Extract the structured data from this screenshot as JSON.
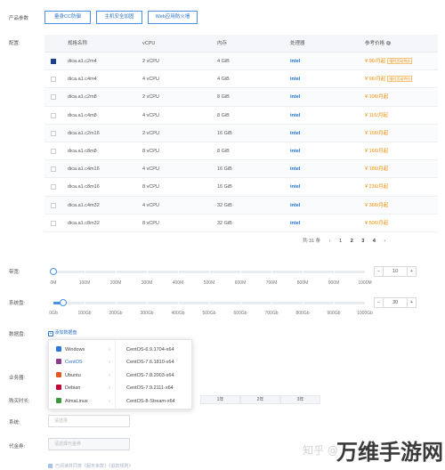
{
  "product": {
    "label": "产品参数",
    "buttons": [
      "量身CC防御",
      "主机安全加固",
      "Web应用防火墙"
    ]
  },
  "config": {
    "label": "配置:"
  },
  "table": {
    "headers": [
      "",
      "规格名称",
      "vCPU",
      "内存",
      "处理器",
      "参考价格"
    ],
    "rows": [
      {
        "name": "dica.a1.c2m4",
        "vcpu": "2 vCPU",
        "mem": "4 GiB",
        "cpu": "intel",
        "price": "¥ 96/月起",
        "badge": "限时活动特价",
        "checked": true
      },
      {
        "name": "dica.a1.c4m4",
        "vcpu": "4 vCPU",
        "mem": "4 GiB",
        "cpu": "intel",
        "price": "¥ 96/月起",
        "badge": "限时活动特价",
        "checked": false
      },
      {
        "name": "dica.a1.c2m8",
        "vcpu": "2 vCPU",
        "mem": "8 GiB",
        "cpu": "intel",
        "price": "¥ 106/月起",
        "badge": "",
        "checked": false
      },
      {
        "name": "dica.a1.c4m8",
        "vcpu": "4 vCPU",
        "mem": "8 GiB",
        "cpu": "intel",
        "price": "¥ 116/月起",
        "badge": "",
        "checked": false
      },
      {
        "name": "dica.a1.c2m16",
        "vcpu": "2 vCPU",
        "mem": "16 GiB",
        "cpu": "intel",
        "price": "¥ 166/月起",
        "badge": "",
        "checked": false
      },
      {
        "name": "dica.a1.c8m8",
        "vcpu": "8 vCPU",
        "mem": "8 GiB",
        "cpu": "intel",
        "price": "¥ 166/月起",
        "badge": "",
        "checked": false
      },
      {
        "name": "dica.a1.c4m16",
        "vcpu": "4 vCPU",
        "mem": "16 GiB",
        "cpu": "intel",
        "price": "¥ 186/月起",
        "badge": "",
        "checked": false
      },
      {
        "name": "dica.a1.c8m16",
        "vcpu": "8 vCPU",
        "mem": "16 GiB",
        "cpu": "intel",
        "price": "¥ 236/月起",
        "badge": "",
        "checked": false
      },
      {
        "name": "dica.a1.c4m32",
        "vcpu": "4 vCPU",
        "mem": "32 GiB",
        "cpu": "intel",
        "price": "¥ 366/月起",
        "badge": "",
        "checked": false
      },
      {
        "name": "dica.a1.c8m32",
        "vcpu": "8 vCPU",
        "mem": "32 GiB",
        "cpu": "intel",
        "price": "¥ 506/月起",
        "badge": "",
        "checked": false
      }
    ]
  },
  "pagination": {
    "total": "共 31 条",
    "prev": "‹",
    "pages": [
      "1",
      "2",
      "3",
      "4"
    ],
    "current": "1",
    "next": "›"
  },
  "bandwidth": {
    "label": "带宽:",
    "ticks": [
      "0M",
      "100M",
      "200M",
      "300M",
      "400M",
      "500M",
      "600M",
      "700M",
      "800M",
      "900M",
      "1000M"
    ],
    "value": "10",
    "minus": "−",
    "plus": "+",
    "level": 0
  },
  "sysdisk": {
    "label": "系统盘:",
    "ticks": [
      "0Gb",
      "100Gb",
      "200Gb",
      "300Gb",
      "400Gb",
      "500Gb",
      "600Gb",
      "700Gb",
      "800Gb",
      "900Gb",
      "1000Gb"
    ],
    "value": "30",
    "minus": "−",
    "plus": "+",
    "level": 0.03
  },
  "datadisk": {
    "label": "数据盘:",
    "add": "添加数据盘"
  },
  "os_menu": {
    "families": [
      {
        "label": "Windows",
        "icon": "windows-icon",
        "color": "#2b78d6"
      },
      {
        "label": "CentOS",
        "icon": "centos-icon",
        "color": "#8e3c8e"
      },
      {
        "label": "Ubuntu",
        "icon": "ubuntu-icon",
        "color": "#e95420"
      },
      {
        "label": "Debian",
        "icon": "debian-icon",
        "color": "#c70036"
      },
      {
        "label": "AlmaLinux",
        "icon": "almalinux-icon",
        "color": "#3a9a3a"
      }
    ],
    "versions": [
      "CentOS-6.9.1704-x64",
      "CentOS-7.6.1810-x64",
      "CentOS-7.8.2003-x64",
      "CentOS-7.9.2111-x64",
      "CentOS-8-Stream-x64"
    ]
  },
  "security": {
    "label": "业务器:"
  },
  "duration": {
    "label": "购买时长:",
    "options": [
      "1年",
      "2年",
      "3年"
    ]
  },
  "system": {
    "label": "系统:",
    "placeholder": "请选择"
  },
  "region": {
    "label": "代金券:",
    "placeholder": "请选择代金券"
  },
  "agreement": {
    "text": "已阅读并同意《服务条款》《退款规则》"
  },
  "watermark": {
    "site": "知乎 @",
    "brand": "万维手游网"
  }
}
